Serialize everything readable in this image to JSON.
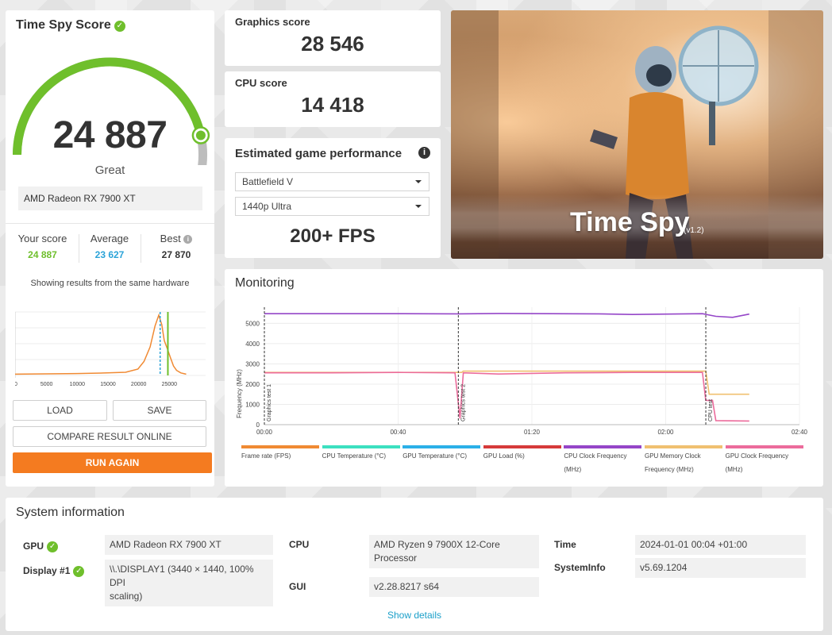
{
  "score": {
    "title": "Time Spy Score",
    "value": "24 887",
    "rating": "Great",
    "gauge_fraction": 0.88,
    "gpu": "AMD Radeon RX 7900 XT",
    "your_label": "Your score",
    "your_value": "24 887",
    "avg_label": "Average",
    "avg_value": "23 627",
    "best_label": "Best",
    "best_value": "27 870",
    "caption": "Showing results from the same hardware",
    "hist_ticks": [
      "0",
      "5000",
      "10000",
      "15000",
      "20000",
      "25000"
    ],
    "buttons": {
      "load": "LOAD",
      "save": "SAVE",
      "compare": "COMPARE RESULT ONLINE",
      "run": "RUN AGAIN"
    }
  },
  "graphics": {
    "label": "Graphics score",
    "value": "28 546"
  },
  "cpu": {
    "label": "CPU score",
    "value": "14 418"
  },
  "perf": {
    "title": "Estimated game performance",
    "game": "Battlefield V",
    "setting": "1440p Ultra",
    "fps": "200+ FPS"
  },
  "hero": {
    "title": "Time Spy",
    "version": "(v1.2)"
  },
  "monitoring": {
    "title": "Monitoring",
    "y_axis_label": "Frequency (MHz)",
    "y_ticks": [
      "5000",
      "4000",
      "3000",
      "2000",
      "1000",
      "0"
    ],
    "x_ticks": [
      "00:00",
      "00:40",
      "01:20",
      "02:00",
      "02:40"
    ],
    "markers": [
      "Graphics test 1",
      "Graphics test 2",
      "CPU test"
    ],
    "legend": [
      {
        "label": "Frame rate (FPS)",
        "color": "#f08a33"
      },
      {
        "label": "CPU Temperature (°C)",
        "color": "#3ce0c0"
      },
      {
        "label": "GPU Temperature (°C)",
        "color": "#2bb0e8"
      },
      {
        "label": "GPU Load (%)",
        "color": "#d63a3a"
      },
      {
        "label": "CPU Clock Frequency (MHz)",
        "color": "#9546c8"
      },
      {
        "label": "GPU Memory Clock Frequency (MHz)",
        "color": "#f0c070"
      },
      {
        "label": "GPU Clock Frequency (MHz)",
        "color": "#ec6c9c"
      }
    ]
  },
  "sysinfo": {
    "title": "System information",
    "gpu_key": "GPU",
    "gpu_val": "AMD Radeon RX 7900 XT",
    "display_key": "Display #1",
    "display_val_1": "\\\\.\\DISPLAY1 (3440 × 1440, 100% DPI",
    "display_val_2": "scaling)",
    "cpu_key": "CPU",
    "cpu_val_1": "AMD Ryzen 9 7900X 12-Core",
    "cpu_val_2": "Processor",
    "gui_key": "GUI",
    "gui_val": "v2.28.8217 s64",
    "time_key": "Time",
    "time_val": "2024-01-01 00:04 +01:00",
    "sysinfo_key": "SystemInfo",
    "sysinfo_val": "v5.69.1204",
    "show_details": "Show details"
  },
  "colors": {
    "accent_green": "#6fbf2c",
    "accent_blue": "#2ba3d8",
    "accent_orange": "#f47b20"
  }
}
